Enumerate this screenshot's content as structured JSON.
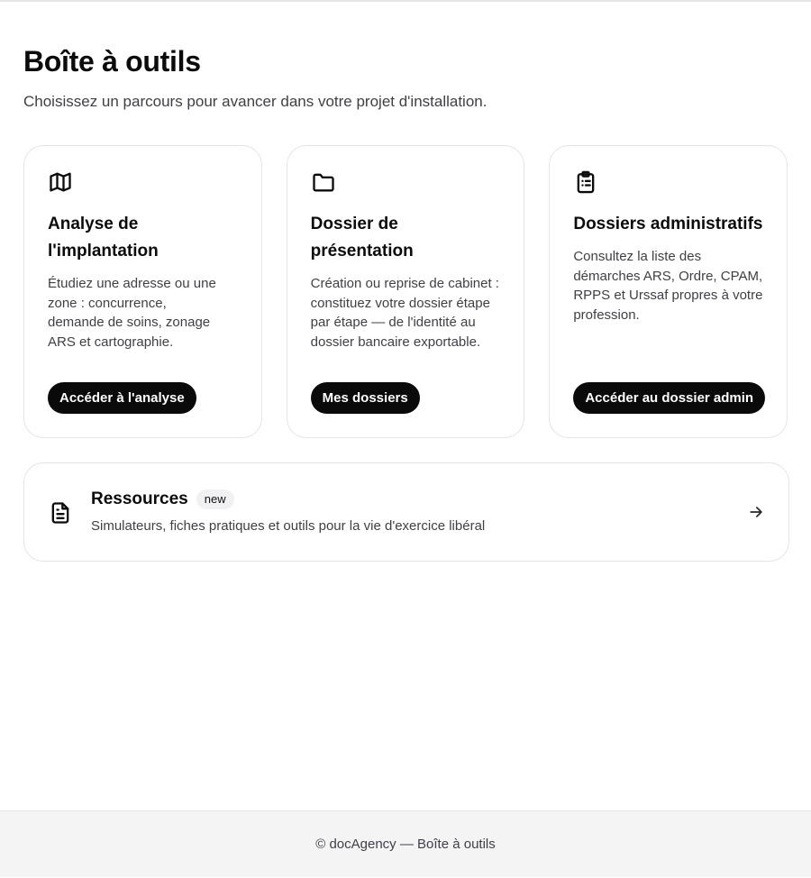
{
  "page": {
    "title": "Boîte à outils",
    "subtitle": "Choisissez un parcours pour avancer dans votre projet d'installation."
  },
  "cards": [
    {
      "icon": "map-icon",
      "title": "Analyse de l'implantation",
      "description": "Étudiez une adresse ou une zone : concurrence, demande de soins, zonage ARS et cartographie.",
      "button": "Accéder à l'analyse"
    },
    {
      "icon": "folder-icon",
      "title": "Dossier de présentation",
      "description": "Création ou reprise de cabinet : constituez votre dossier étape par étape — de l'identité au dossier bancaire exportable.",
      "button": "Mes dossiers"
    },
    {
      "icon": "clipboard-list-icon",
      "title": "Dossiers administratifs",
      "description": "Consultez la liste des démarches ARS, Ordre, CPAM, RPPS et Urssaf propres à votre profession.",
      "button": "Accéder au dossier admin"
    }
  ],
  "resources": {
    "icon": "document-icon",
    "title": "Ressources",
    "badge": "new",
    "description": "Simulateurs, fiches pratiques et outils pour la vie d'exercice libéral",
    "arrow_icon": "arrow-right-icon"
  },
  "footer": {
    "text": "© docAgency — Boîte à outils"
  }
}
